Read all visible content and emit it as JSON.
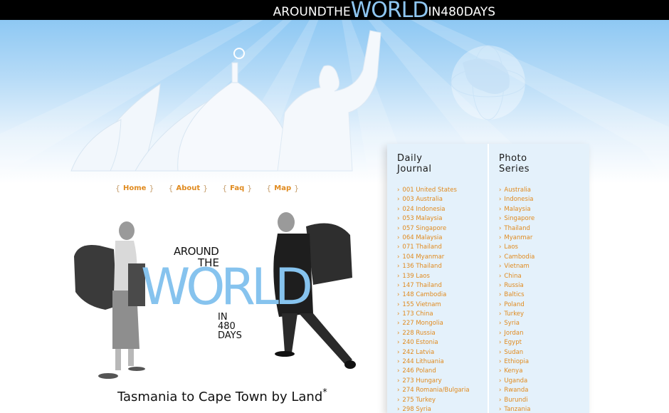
{
  "header": {
    "title_prefix": "AROUNDTHE",
    "title_big": "WORLD",
    "title_suffix": "IN480DAYS"
  },
  "nav": {
    "items": [
      {
        "label": "Home"
      },
      {
        "label": "About"
      },
      {
        "label": "Faq"
      },
      {
        "label": "Map"
      }
    ]
  },
  "hero": {
    "around": "AROUND",
    "the": "THE",
    "world": "WORLD",
    "in": "IN",
    "number": "480",
    "days": "DAYS",
    "tagline": "Tasmania to Cape Town by Land",
    "tagline_mark": "*"
  },
  "journal": {
    "title_line1": "Daily",
    "title_line2": "Journal",
    "items": [
      "001 United States",
      "003 Australia",
      "024 Indonesia",
      "053 Malaysia",
      "057 Singapore",
      "064 Malaysia",
      "071 Thailand",
      "104 Myanmar",
      "136 Thailand",
      "139 Laos",
      "147 Thailand",
      "148 Cambodia",
      "155 Vietnam",
      "173 China",
      "227 Mongolia",
      "228 Russia",
      "240 Estonia",
      "242 Latvia",
      "244 Lithuania",
      "246 Poland",
      "273 Hungary",
      "274 Romania/Bulgaria",
      "275 Turkey",
      "298 Syria"
    ]
  },
  "photos": {
    "title_line1": "Photo",
    "title_line2": "Series",
    "items": [
      "Australia",
      "Indonesia",
      "Malaysia",
      "Singapore",
      "Thailand",
      "Myanmar",
      "Laos",
      "Cambodia",
      "Vietnam",
      "China",
      "Russia",
      "Baltics",
      "Poland",
      "Turkey",
      "Syria",
      "Jordan",
      "Egypt",
      "Sudan",
      "Ethiopia",
      "Kenya",
      "Uganda",
      "Rwanda",
      "Burundi",
      "Tanzania"
    ]
  },
  "colors": {
    "accent_orange": "#e08a1e",
    "sky_blue": "#8ec6f1",
    "panel_bg": "#e4f1fb"
  },
  "icons": {
    "list_bullet": "chevron-right-icon"
  }
}
